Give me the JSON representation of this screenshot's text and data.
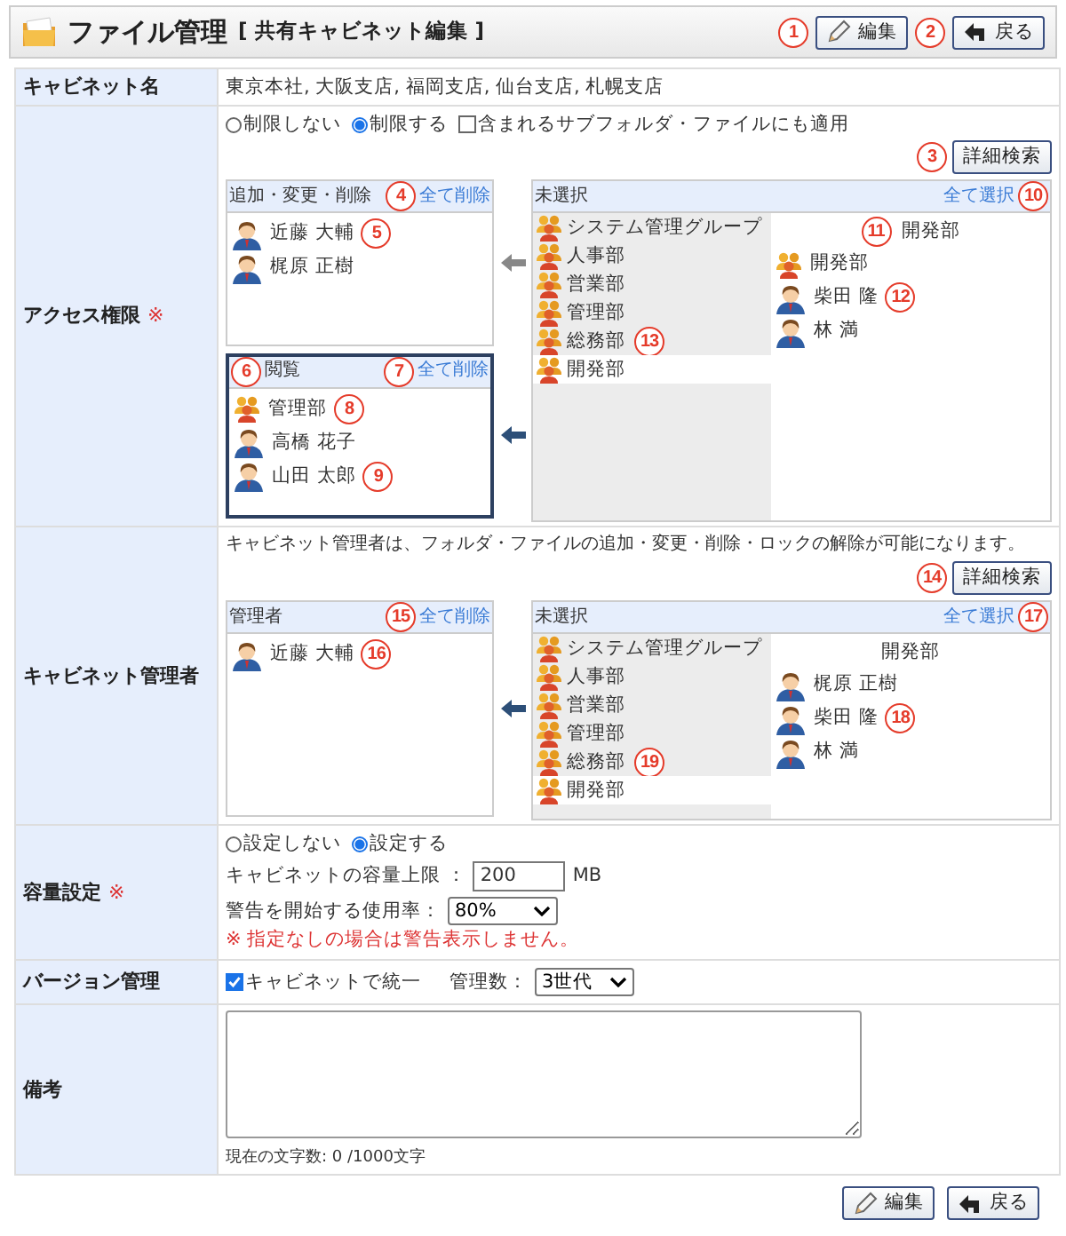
{
  "header": {
    "title": "ファイル管理",
    "subtitle": "[ 共有キャビネット編集 ]",
    "buttons": [
      {
        "label": "編集"
      },
      {
        "label": "戻る"
      }
    ]
  },
  "cabinet_name": {
    "label": "キャビネット名",
    "value": "東京本社, 大阪支店, 福岡支店, 仙台支店, 札幌支店"
  },
  "access": {
    "label": "アクセス権限",
    "required_mark": "※",
    "options": [
      {
        "label": "制限しない",
        "selected": false
      },
      {
        "label": "制限する",
        "selected": true
      }
    ],
    "subfolder": {
      "label": "含まれるサブフォルダ・ファイルにも適用",
      "checked": false
    },
    "search_button": "詳細検索",
    "targets": [
      {
        "title": "追加・変更・削除",
        "clear_link": "全て削除",
        "selected": false,
        "members": [
          {
            "kind": "user",
            "name": "近藤 大輔"
          },
          {
            "kind": "user",
            "name": "梶原 正樹"
          }
        ]
      },
      {
        "title": "閲覧",
        "clear_link": "全て削除",
        "selected": true,
        "members": [
          {
            "kind": "group",
            "name": "管理部"
          },
          {
            "kind": "user",
            "name": "高橋 花子"
          },
          {
            "kind": "user",
            "name": "山田 太郎"
          }
        ]
      }
    ],
    "pool": {
      "title": "未選択",
      "select_all": "全て選択",
      "groups": [
        {
          "name": "システム管理グループ",
          "selected": false
        },
        {
          "name": "人事部",
          "selected": false
        },
        {
          "name": "営業部",
          "selected": false
        },
        {
          "name": "管理部",
          "selected": false
        },
        {
          "name": "総務部",
          "selected": false
        },
        {
          "name": "開発部",
          "selected": true
        }
      ],
      "group_heading": "開発部",
      "members": [
        {
          "kind": "group",
          "name": "開発部"
        },
        {
          "kind": "user",
          "name": "柴田 隆"
        },
        {
          "kind": "user",
          "name": "林 満"
        }
      ]
    }
  },
  "manager": {
    "label": "キャビネット管理者",
    "note": "キャビネット管理者は、フォルダ・ファイルの追加・変更・削除・ロックの解除が可能になります。",
    "search_button": "詳細検索",
    "targets": [
      {
        "title": "管理者",
        "clear_link": "全て削除",
        "selected": false,
        "members": [
          {
            "kind": "user",
            "name": "近藤 大輔"
          }
        ]
      }
    ],
    "pool": {
      "title": "未選択",
      "select_all": "全て選択",
      "groups": [
        {
          "name": "システム管理グループ",
          "selected": false
        },
        {
          "name": "人事部",
          "selected": false
        },
        {
          "name": "営業部",
          "selected": false
        },
        {
          "name": "管理部",
          "selected": false
        },
        {
          "name": "総務部",
          "selected": false
        },
        {
          "name": "開発部",
          "selected": true
        }
      ],
      "group_heading": "開発部",
      "members": [
        {
          "kind": "user",
          "name": "梶原 正樹"
        },
        {
          "kind": "user",
          "name": "柴田 隆"
        },
        {
          "kind": "user",
          "name": "林 満"
        }
      ]
    }
  },
  "capacity": {
    "label": "容量設定",
    "required_mark": "※",
    "options": [
      {
        "label": "設定しない",
        "selected": false
      },
      {
        "label": "設定する",
        "selected": true
      }
    ],
    "limit_label": "キャビネットの容量上限 ：",
    "limit_value": "200",
    "limit_unit": "MB",
    "warn_label": "警告を開始する使用率：",
    "warn_value": "80%",
    "note": "※ 指定なしの場合は警告表示しません。"
  },
  "version": {
    "label": "バージョン管理",
    "unify": {
      "label": "キャビネットで統一",
      "checked": true
    },
    "count_label": "管理数：",
    "count_value": "3世代"
  },
  "remarks": {
    "label": "備考",
    "counter": "現在の文字数: 0 /1000文字"
  },
  "footer_buttons": [
    {
      "label": "編集"
    },
    {
      "label": "戻る"
    }
  ],
  "callouts": [
    "1",
    "2",
    "3",
    "4",
    "5",
    "6",
    "7",
    "8",
    "9",
    "10",
    "11",
    "12",
    "13",
    "14",
    "15",
    "16",
    "17",
    "18",
    "19"
  ]
}
